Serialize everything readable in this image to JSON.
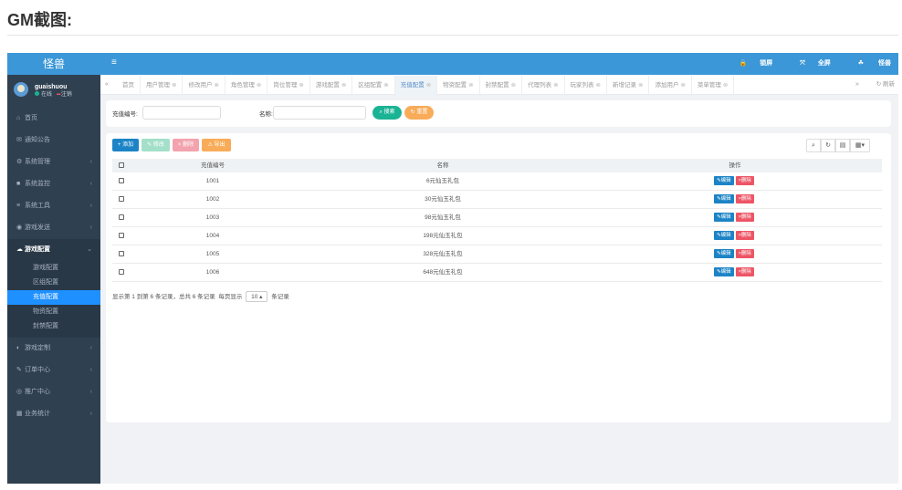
{
  "page": {
    "heading": "GM截图:"
  },
  "sidebar": {
    "brand": "怪兽",
    "user": {
      "name": "guaishuou",
      "status_online": "在线",
      "logout": "注销"
    },
    "items": [
      {
        "label": "首页",
        "icon": "home-icon",
        "glyph": "⌂",
        "has_caret": false
      },
      {
        "label": "通知公告",
        "icon": "megaphone-icon",
        "glyph": "✉",
        "has_caret": false
      },
      {
        "label": "系统管理",
        "icon": "gear-icon",
        "glyph": "⚙",
        "has_caret": true
      },
      {
        "label": "系统监控",
        "icon": "video-icon",
        "glyph": "■",
        "has_caret": true
      },
      {
        "label": "系统工具",
        "icon": "bars-icon",
        "glyph": "≡",
        "has_caret": true
      },
      {
        "label": "游戏发送",
        "icon": "send-icon",
        "glyph": "◉",
        "has_caret": true
      },
      {
        "label": "游戏配置",
        "icon": "cloud-icon",
        "glyph": "☁",
        "has_caret": true,
        "open": true
      },
      {
        "label": "游戏定制",
        "icon": "gamepad-icon",
        "glyph": "◐",
        "has_caret": true
      },
      {
        "label": "订单中心",
        "icon": "pencil-icon",
        "glyph": "✎",
        "has_caret": true
      },
      {
        "label": "推广中心",
        "icon": "eye-icon",
        "glyph": "◎",
        "has_caret": true
      },
      {
        "label": "业务统计",
        "icon": "chart-icon",
        "glyph": "▦",
        "has_caret": true
      }
    ],
    "subitems": [
      {
        "label": "游戏配置",
        "active": false
      },
      {
        "label": "区组配置",
        "active": false
      },
      {
        "label": "充值配置",
        "active": true
      },
      {
        "label": "物资配置",
        "active": false
      },
      {
        "label": "封禁配置",
        "active": false
      }
    ]
  },
  "topbar": {
    "toggle": "≡",
    "lock": "锁屏",
    "fullscreen": "全屏",
    "user": "怪兽"
  },
  "tabs": {
    "prev": "«",
    "next": "»",
    "refresh": "刷新",
    "items": [
      {
        "label": "首页",
        "active": false,
        "closable": false
      },
      {
        "label": "用户管理",
        "active": false,
        "closable": true
      },
      {
        "label": "修改用户",
        "active": false,
        "closable": true
      },
      {
        "label": "角色管理",
        "active": false,
        "closable": true
      },
      {
        "label": "岗位管理",
        "active": false,
        "closable": true
      },
      {
        "label": "游戏配置",
        "active": false,
        "closable": true
      },
      {
        "label": "区组配置",
        "active": false,
        "closable": true
      },
      {
        "label": "充值配置",
        "active": true,
        "closable": true
      },
      {
        "label": "物资配置",
        "active": false,
        "closable": true
      },
      {
        "label": "封禁配置",
        "active": false,
        "closable": true
      },
      {
        "label": "代理列表",
        "active": false,
        "closable": true
      },
      {
        "label": "玩家列表",
        "active": false,
        "closable": true
      },
      {
        "label": "新增记录",
        "active": false,
        "closable": true
      },
      {
        "label": "添加用户",
        "active": false,
        "closable": true
      },
      {
        "label": "菜单管理",
        "active": false,
        "closable": true
      }
    ]
  },
  "search": {
    "code_label": "充值编号:",
    "code_value": "",
    "name_label": "名称:",
    "name_value": "",
    "search_button": "搜索",
    "reset_button": "重置"
  },
  "toolbar": {
    "add": "添加",
    "edit": "修改",
    "delete": "删除",
    "export": "导出"
  },
  "table": {
    "headers": {
      "code": "充值编号",
      "name": "名称",
      "ops": "操作"
    },
    "rows": [
      {
        "code": "1001",
        "name": "6元仙玉礼包"
      },
      {
        "code": "1002",
        "name": "30元仙玉礼包"
      },
      {
        "code": "1003",
        "name": "98元仙玉礼包"
      },
      {
        "code": "1004",
        "name": "198元仙玉礼包"
      },
      {
        "code": "1005",
        "name": "328元仙玉礼包"
      },
      {
        "code": "1006",
        "name": "648元仙玉礼包"
      }
    ],
    "edit_label": "编辑",
    "delete_label": "删除"
  },
  "pagination": {
    "summary": "显示第 1 到第 6 条记录，总共 6 条记录",
    "per_page_prefix": "每页显示",
    "page_size": "10",
    "per_page_suffix": "条记录"
  }
}
